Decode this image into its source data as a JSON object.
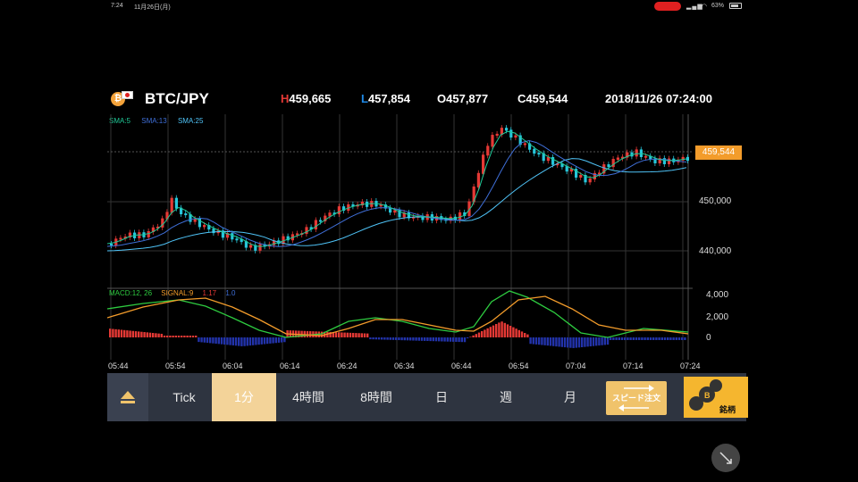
{
  "status": {
    "time": "7:24",
    "date": "11月26日(月)",
    "battery": "63%"
  },
  "header": {
    "pair": "BTC/JPY",
    "high_letter": "H",
    "high": "459,665",
    "low_letter": "L",
    "low": "457,854",
    "open_letter": "O",
    "open": "457,877",
    "close_letter": "C",
    "close": "459,544",
    "datetime": "2018/11/26 07:24:00"
  },
  "legend": {
    "sma5": "SMA:5",
    "sma13": "SMA:13",
    "sma25": "SMA:25"
  },
  "price_axis": {
    "current": "459,544",
    "p450": "450,000",
    "p440": "440,000"
  },
  "macd_legend": {
    "macd": "MACD:12, 26",
    "signal": "SIGNAL:9",
    "hist_a": "1.17",
    "hist_b": "1.0"
  },
  "macd_axis": {
    "a": "4,000",
    "b": "2,000",
    "c": "0"
  },
  "time_axis": [
    "05:44",
    "05:54",
    "06:04",
    "06:14",
    "06:24",
    "06:34",
    "06:44",
    "06:54",
    "07:04",
    "07:14",
    "07:24"
  ],
  "tabs": {
    "tick": "Tick",
    "m1": "1分",
    "h4": "4時間",
    "h8": "8時間",
    "day": "日",
    "week": "週",
    "month": "月"
  },
  "speed_order": "スピード注文",
  "brand": "銘柄",
  "colors": {
    "up": "#e53935",
    "down": "#26c6da",
    "sma5": "#20c997",
    "sma13": "#3f6fd8",
    "sma25": "#4fc3f7",
    "macd": "#2ecc40",
    "signal": "#f39c2b",
    "accent": "#f39c2b"
  }
}
